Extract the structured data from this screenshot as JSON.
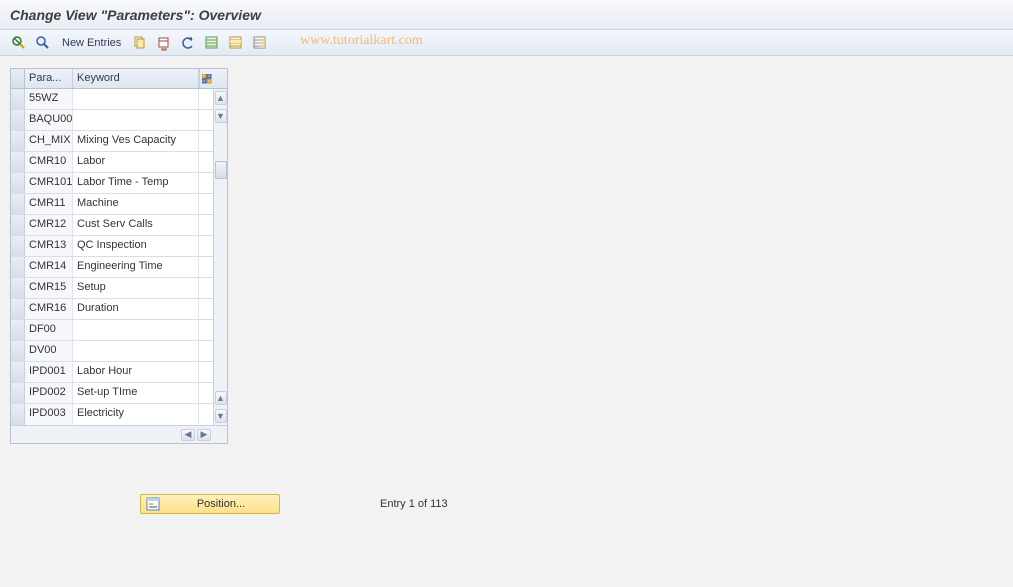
{
  "title": "Change View \"Parameters\": Overview",
  "toolbar": {
    "new_entries_label": "New Entries"
  },
  "watermark": "www.tutorialkart.com",
  "grid": {
    "columns": {
      "param": "Para...",
      "keyword": "Keyword"
    },
    "rows": [
      {
        "param": "55WZ",
        "keyword": ""
      },
      {
        "param": "BAQU00",
        "keyword": ""
      },
      {
        "param": "CH_MIX",
        "keyword": "Mixing Ves Capacity"
      },
      {
        "param": "CMR10",
        "keyword": "Labor"
      },
      {
        "param": "CMR101",
        "keyword": "Labor Time - Temp"
      },
      {
        "param": "CMR11",
        "keyword": "Machine"
      },
      {
        "param": "CMR12",
        "keyword": "Cust Serv Calls"
      },
      {
        "param": "CMR13",
        "keyword": "QC Inspection"
      },
      {
        "param": "CMR14",
        "keyword": "Engineering Time"
      },
      {
        "param": "CMR15",
        "keyword": "Setup"
      },
      {
        "param": "CMR16",
        "keyword": "Duration"
      },
      {
        "param": "DF00",
        "keyword": ""
      },
      {
        "param": "DV00",
        "keyword": ""
      },
      {
        "param": "IPD001",
        "keyword": "Labor Hour"
      },
      {
        "param": "IPD002",
        "keyword": "Set-up TIme"
      },
      {
        "param": "IPD003",
        "keyword": "Electricity"
      }
    ]
  },
  "footer": {
    "position_label": "Position...",
    "entry_status": "Entry 1 of 113"
  }
}
